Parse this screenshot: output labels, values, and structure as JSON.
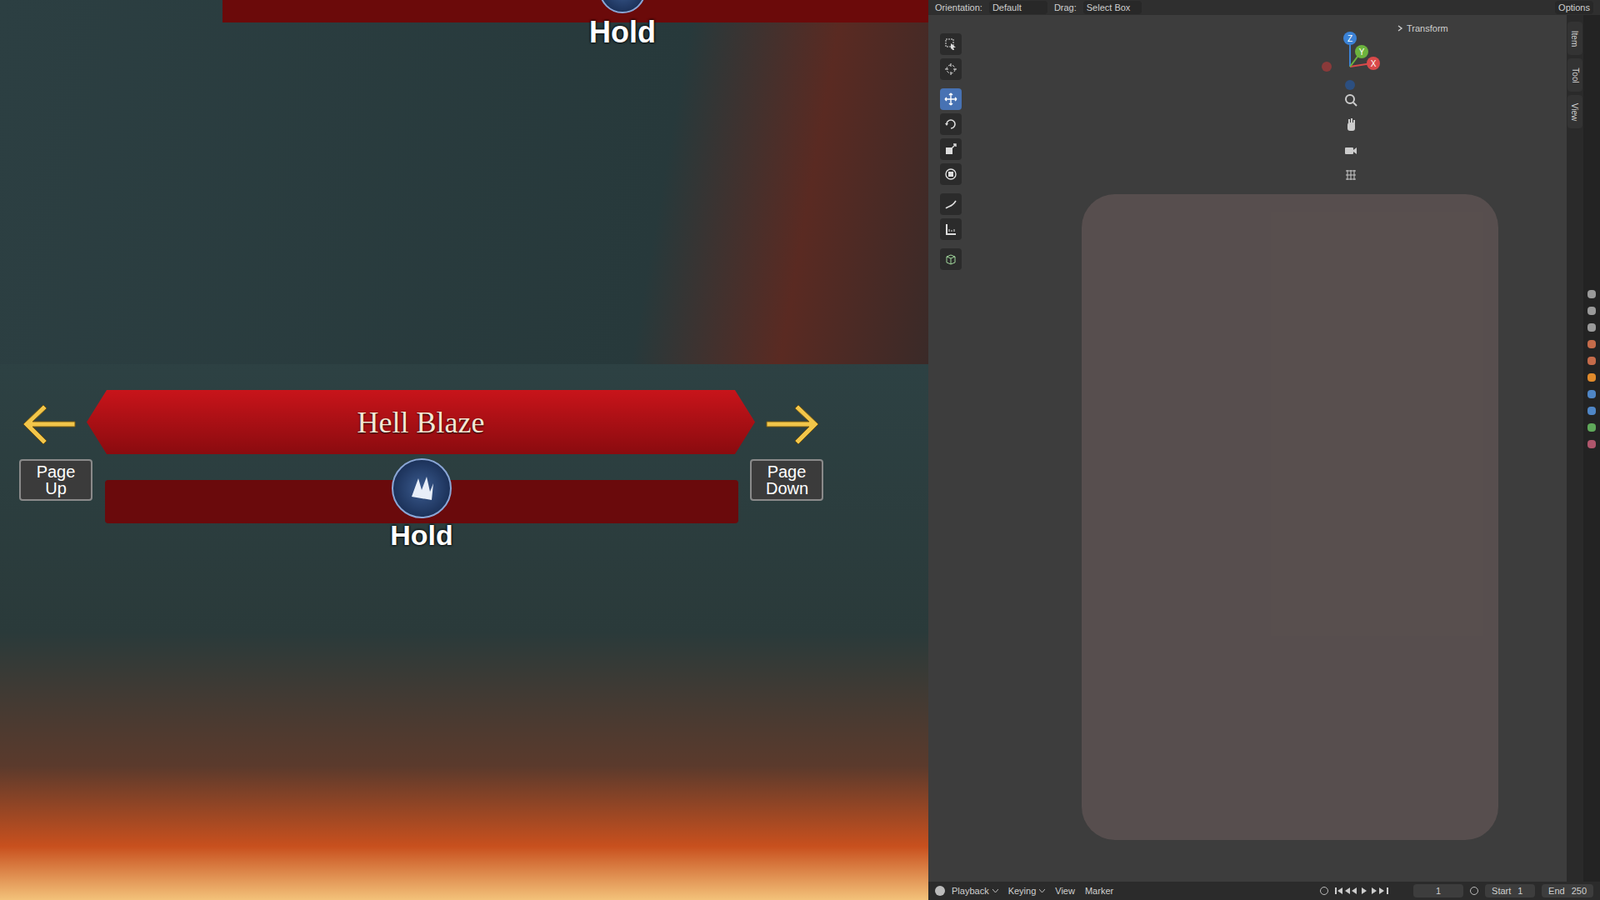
{
  "game_top": {
    "hold_label": "Hold"
  },
  "game_bottom": {
    "skill_name": "Hell Blaze",
    "page_up": "Page Up",
    "page_down": "Page Down",
    "hold_label": "Hold"
  },
  "blender": {
    "header": {
      "orientation_label": "Orientation:",
      "orientation_value": "Default",
      "drag_label": "Drag:",
      "drag_value": "Select Box",
      "options": "Options"
    },
    "tools": [
      {
        "selected": false
      },
      {
        "selected": false
      },
      {
        "selected": true
      },
      {
        "selected": false
      },
      {
        "selected": false
      },
      {
        "selected": false
      },
      {
        "selected": false
      },
      {
        "selected": false
      },
      {
        "selected": false
      }
    ],
    "transform_panel": {
      "label": "Transform",
      "expanded": false
    },
    "gizmo": {
      "x": "X",
      "y": "Y",
      "z": "Z"
    },
    "sidebar_tabs": [
      {
        "label": "Item",
        "selected": false
      },
      {
        "label": "Tool",
        "selected": false
      },
      {
        "label": "View",
        "selected": false
      }
    ],
    "timeline": {
      "menus": [
        "Playback",
        "Keying",
        "View",
        "Marker"
      ],
      "current_frame": "1",
      "start_label": "Start",
      "start": "1",
      "end_label": "End",
      "end": "250"
    }
  }
}
